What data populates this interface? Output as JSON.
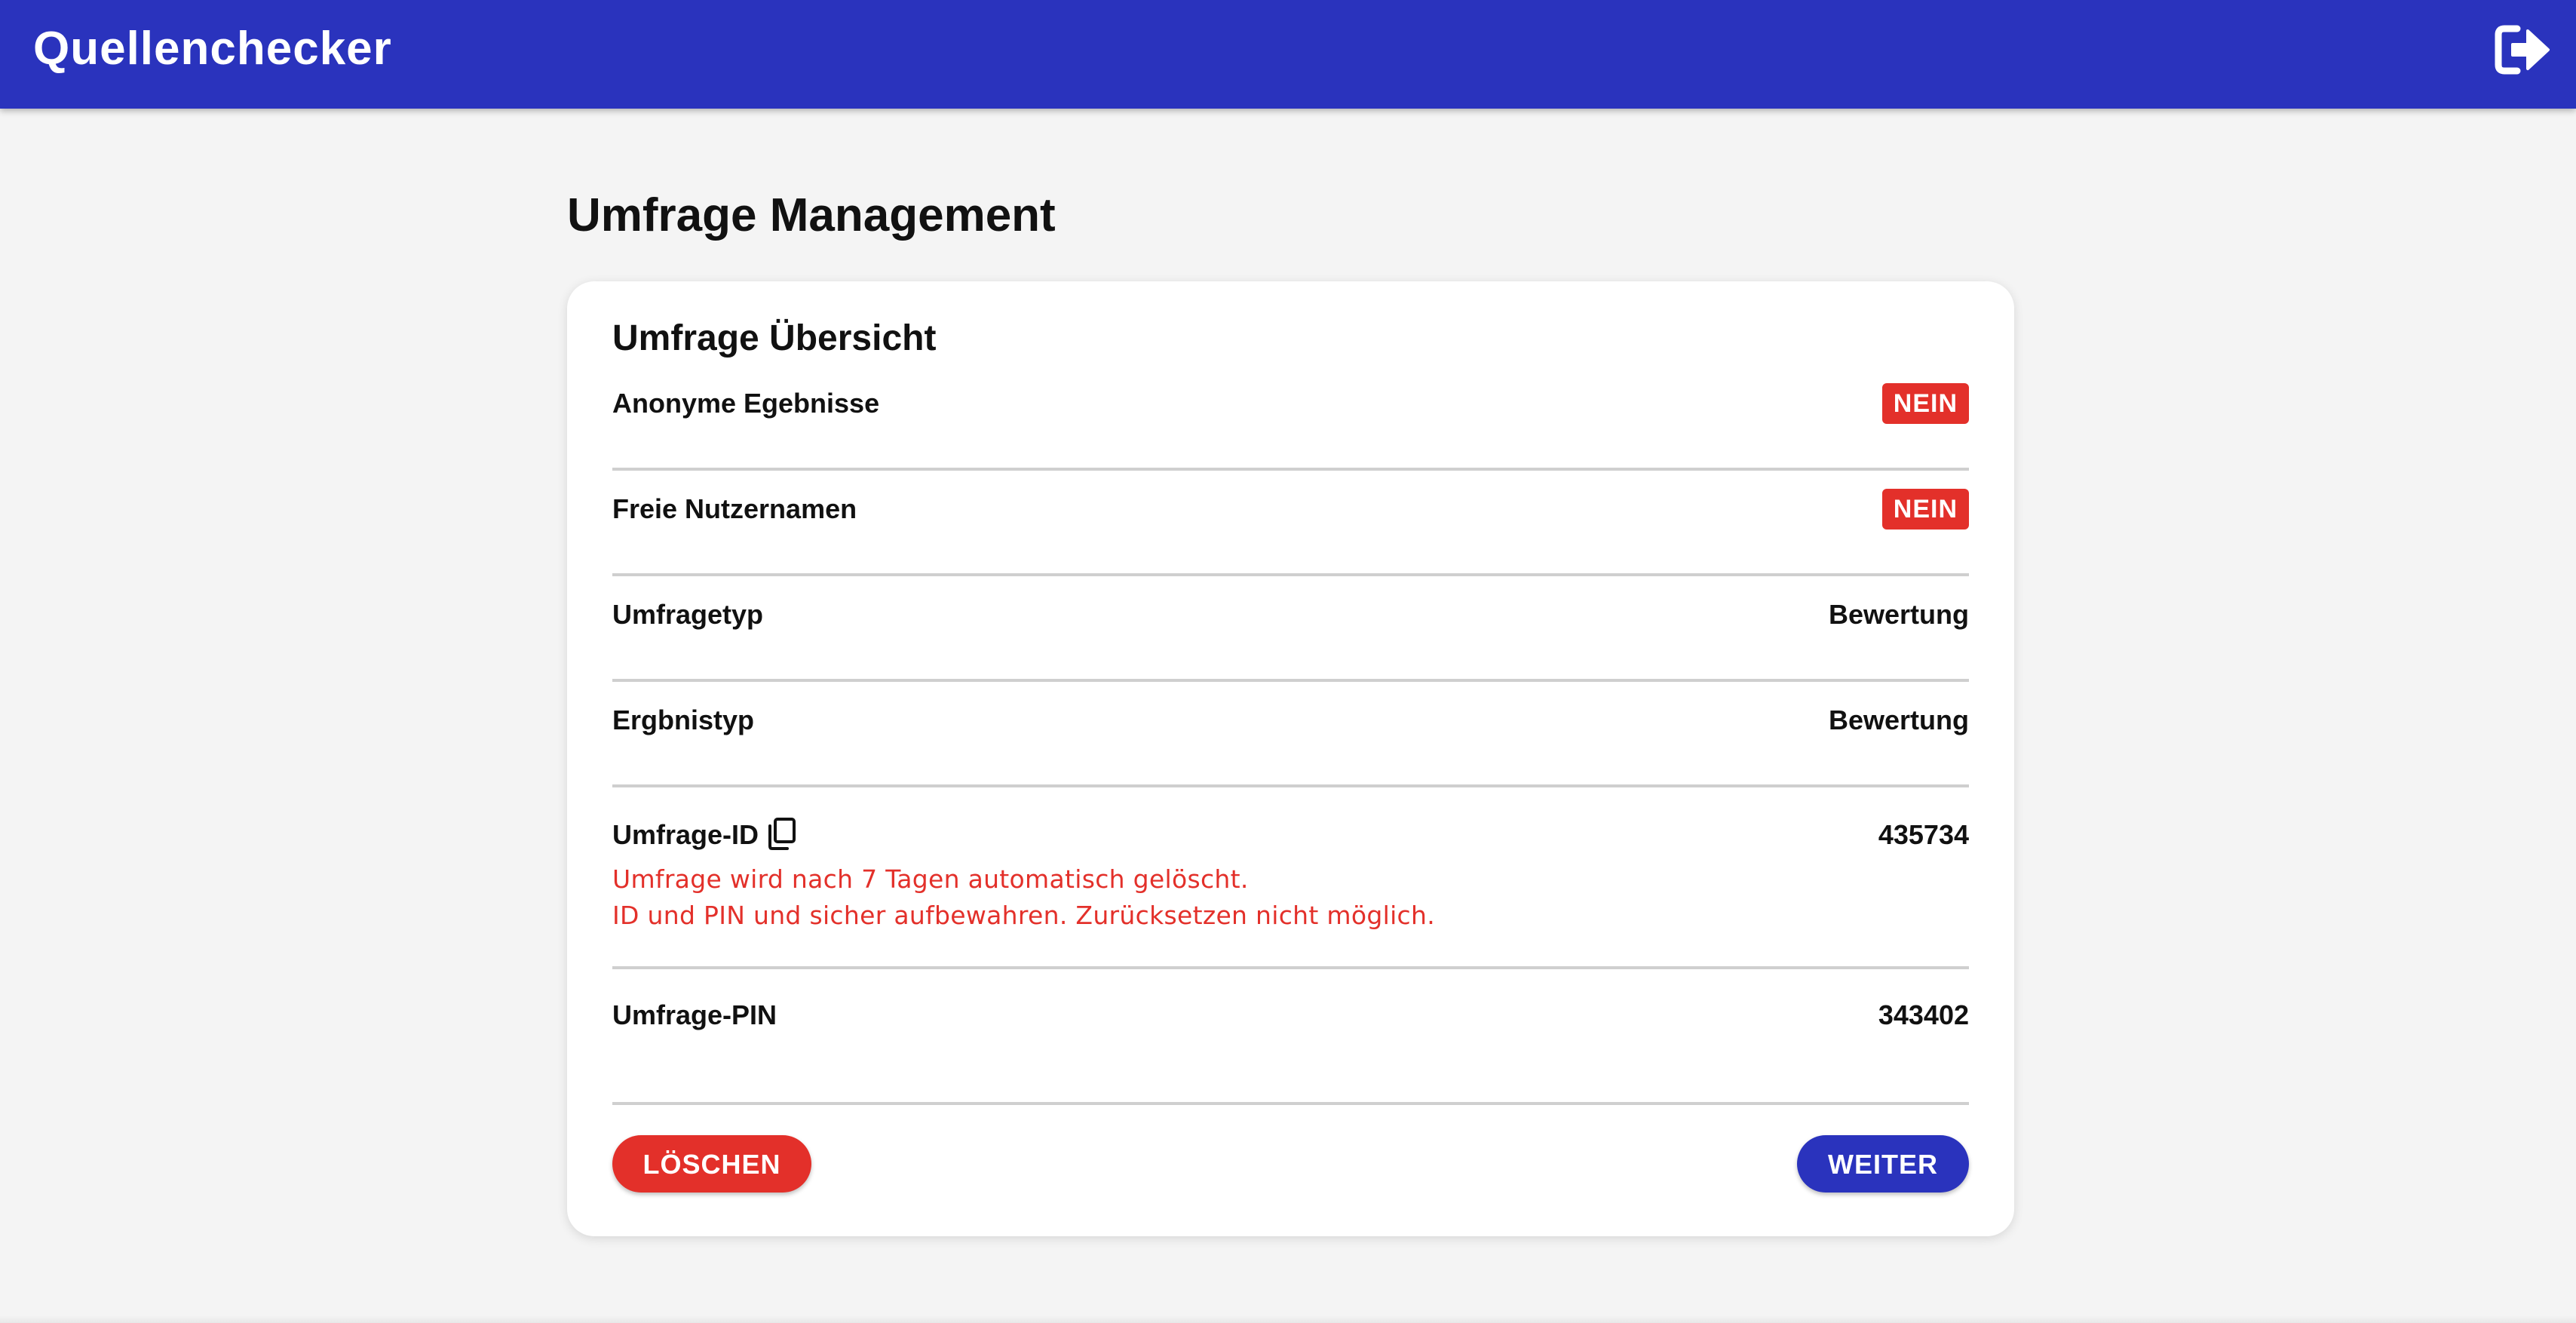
{
  "header": {
    "app_title": "Quellenchecker",
    "logout_icon": "logout-icon"
  },
  "page": {
    "title": "Umfrage Management"
  },
  "card": {
    "title": "Umfrage Übersicht",
    "rows": [
      {
        "label": "Anonyme Egebnisse",
        "value": "NEIN",
        "kind": "badge"
      },
      {
        "label": "Freie Nutzernamen",
        "value": "NEIN",
        "kind": "badge"
      },
      {
        "label": "Umfragetyp",
        "value": "Bewertung",
        "kind": "text"
      },
      {
        "label": "Ergbnistyp",
        "value": "Bewertung",
        "kind": "text"
      },
      {
        "label": "Umfrage-ID",
        "value": "435734",
        "kind": "text",
        "icon": "copy-icon",
        "warnings": [
          "Umfrage wird nach 7 Tagen automatisch gelöscht.",
          "ID und PIN und sicher aufbewahren. Zurücksetzen nicht möglich."
        ]
      },
      {
        "label": "Umfrage-PIN",
        "value": "343402",
        "kind": "text"
      }
    ]
  },
  "actions": {
    "delete_label": "LÖSCHEN",
    "next_label": "WEITER"
  },
  "colors": {
    "primary": "#2a33bd",
    "danger": "#e3302a",
    "background": "#f4f4f4"
  }
}
